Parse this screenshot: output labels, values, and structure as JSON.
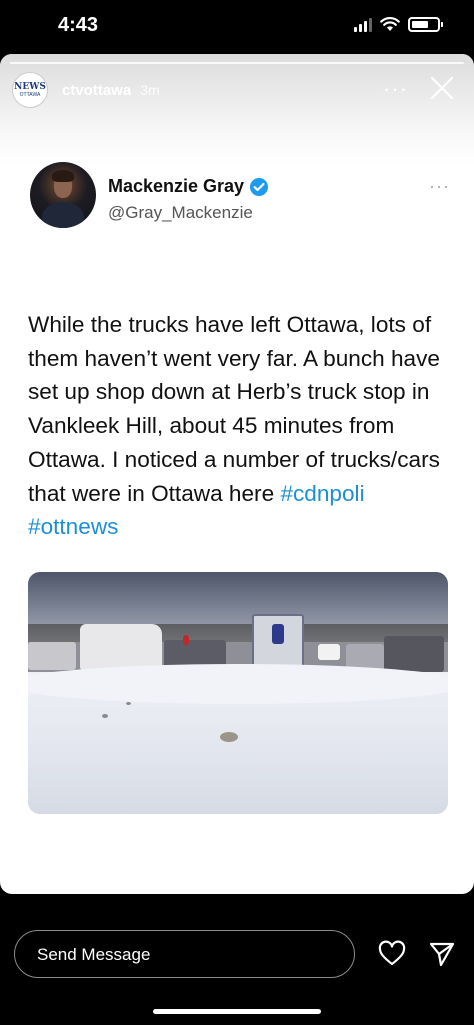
{
  "status_bar": {
    "time": "4:43"
  },
  "story": {
    "username": "ctvottawa",
    "time_ago": "3m",
    "avatar_logo_text": "NEWS OTTAWA",
    "more_label": "···"
  },
  "tweet": {
    "author_name": "Mackenzie Gray",
    "author_handle": "@Gray_Mackenzie",
    "more_label": "···",
    "body_text": "While the trucks have left Ottawa, lots of them haven’t went very far. A bunch have set up shop down at Herb’s truck stop in Vankleek Hill, about 45 minutes from Ottawa. I noticed a number of trucks/cars that were in Ottawa here ",
    "hashtags": [
      "#cdnpoli",
      "#ottnews"
    ]
  },
  "bottom_bar": {
    "message_placeholder": "Send Message"
  },
  "colors": {
    "hashtag": "#1d8fd6",
    "verified": "#1d9bf0"
  }
}
